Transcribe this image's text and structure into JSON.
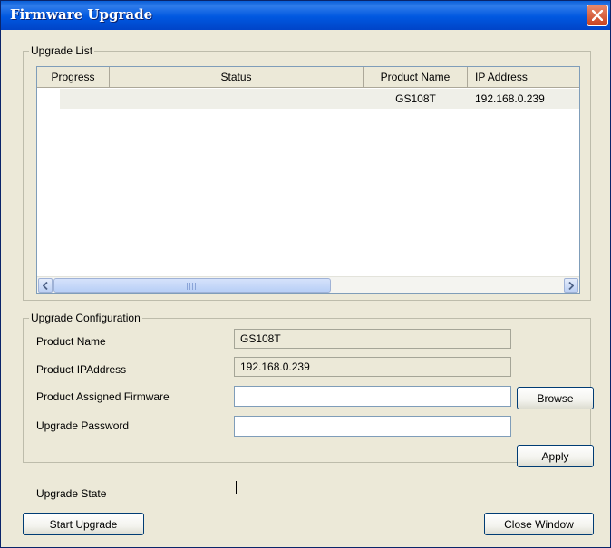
{
  "window": {
    "title": "Firmware Upgrade"
  },
  "upgrade_list": {
    "legend": "Upgrade List",
    "columns": [
      "Progress",
      "Status",
      "Product Name",
      "IP Address"
    ],
    "rows": [
      {
        "progress": "",
        "status": "",
        "product_name": "GS108T",
        "ip_address": "192.168.0.239"
      }
    ],
    "scrollbar_icon_left": "chevron-left-icon",
    "scrollbar_icon_right": "chevron-right-icon"
  },
  "config": {
    "legend": "Upgrade Configuration",
    "product_name_label": "Product Name",
    "product_name_value": "GS108T",
    "product_ip_label": "Product IPAddress",
    "product_ip_value": "192.168.0.239",
    "firmware_label": "Product Assigned Firmware",
    "firmware_value": "",
    "password_label": "Upgrade Password",
    "password_value": "",
    "browse_label": "Browse",
    "apply_label": "Apply"
  },
  "state": {
    "label": "Upgrade State",
    "value": ""
  },
  "footer": {
    "start_label": "Start Upgrade",
    "close_label": "Close Window"
  },
  "colors": {
    "titlebar": "#0058e0",
    "background": "#ece9d8",
    "close": "#c8411e"
  }
}
